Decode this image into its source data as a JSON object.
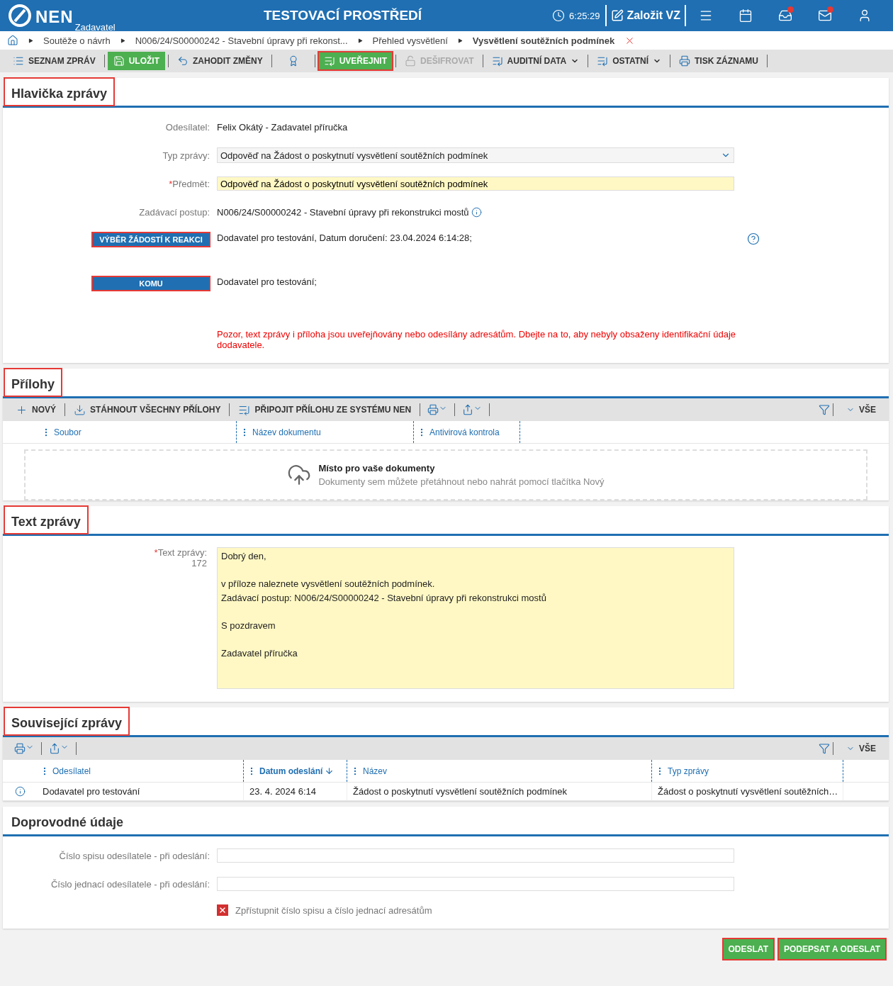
{
  "header": {
    "logo": "NEN",
    "role": "Zadavatel",
    "environment": "TESTOVACÍ PROSTŘEDÍ",
    "time": "6:25:29",
    "create_button": "Založit VZ",
    "icons": [
      {
        "kind": "menu",
        "badge": false
      },
      {
        "kind": "calendar",
        "badge": false
      },
      {
        "kind": "inbox",
        "badge": true
      },
      {
        "kind": "mail",
        "badge": true
      },
      {
        "kind": "user",
        "badge": false
      }
    ]
  },
  "breadcrumbs": [
    {
      "label": "Soutěže o návrh",
      "current": false
    },
    {
      "label": "N006/24/S00000242 - Stavební úpravy při rekonst...",
      "current": false
    },
    {
      "label": "Přehled vysvětlení",
      "current": false
    },
    {
      "label": "Vysvětlení soutěžních podmínek",
      "current": true
    }
  ],
  "toolbar": [
    {
      "label": "SEZNAM ZPRÁV",
      "kind": "plain",
      "highlighted": false,
      "dropdown": false
    },
    {
      "label": "ULOŽIT",
      "kind": "green",
      "highlighted": false,
      "dropdown": false
    },
    {
      "label": "ZAHODIT ZMĚNY",
      "kind": "plain",
      "highlighted": false,
      "dropdown": false
    },
    {
      "kind": "icon",
      "highlighted": false,
      "dropdown": false
    },
    {
      "label": "UVEŘEJNIT",
      "kind": "green",
      "highlighted": true,
      "dropdown": false
    },
    {
      "label": "DEŠIFROVAT",
      "kind": "disabled",
      "highlighted": false,
      "dropdown": false
    },
    {
      "label": "AUDITNÍ DATA",
      "kind": "plain",
      "highlighted": false,
      "dropdown": true
    },
    {
      "label": "OSTATNÍ",
      "kind": "plain",
      "highlighted": false,
      "dropdown": true
    },
    {
      "label": "TISK ZÁZNAMU",
      "kind": "plain",
      "highlighted": false,
      "dropdown": false
    }
  ],
  "message_header": {
    "title": "Hlavička zprávy",
    "highlighted": true,
    "fields": [
      {
        "kind": "static",
        "label": "Odesílatel:",
        "value": "Felix Okátý - Zadavatel příručka"
      },
      {
        "kind": "select",
        "label": "Typ zprávy:",
        "value": "Odpověď na Žádost o poskytnutí vysvětlení soutěžních podmínek"
      },
      {
        "kind": "input",
        "required_mark": "*",
        "label": "Předmět:",
        "value": "Odpověď na Žádost o poskytnutí vysvětlení soutěžních podmínek"
      },
      {
        "kind": "info",
        "label": "Zadávací postup:",
        "value": "N006/24/S00000242 - Stavební úpravy při rekonstrukci mostů"
      },
      {
        "kind": "action",
        "button": "VÝBĚR ŽÁDOSTÍ K REAKCI",
        "highlighted": true,
        "help": true,
        "value": "Dodavatel pro testování, Datum doručení: 23.04.2024 6:14:28;"
      },
      {
        "kind": "action",
        "button": "KOMU",
        "highlighted": true,
        "help": false,
        "value": "Dodavatel pro testování;"
      }
    ],
    "warning": "Pozor, text zprávy i příloha jsou uveřejňovány nebo odesílány adresátům. Dbejte na to, aby nebyly obsaženy identifikační údaje dodavatele."
  },
  "attachments": {
    "title": "Přílohy",
    "highlighted": true,
    "actions": [
      "NOVÝ",
      "STÁHNOUT VŠECHNY PŘÍLOHY",
      "PŘIPOJIT PŘÍLOHU ZE SYSTÉMU NEN"
    ],
    "filter": "VŠE",
    "columns": [
      "Soubor",
      "Název dokumentu",
      "Antivirová kontrola"
    ],
    "dropzone": {
      "title": "Místo pro vaše dokumenty",
      "hint": "Dokumenty sem můžete přetáhnout nebo nahrát pomocí tlačítka Nový"
    }
  },
  "message_text": {
    "title": "Text zprávy",
    "highlighted": true,
    "required_mark": "*",
    "label": "Text zprávy:",
    "count": "172",
    "value": "Dobrý den,\n\nv příloze naleznete vysvětlení soutěžních podmínek.\nZadávací postup: N006/24/S00000242 - Stavební úpravy při rekonstrukci mostů\n\nS pozdravem\n\nZadavatel příručka"
  },
  "related": {
    "title": "Související zprávy",
    "highlighted": true,
    "filter": "VŠE",
    "columns": [
      {
        "label": "Odesílatel",
        "sorted": false
      },
      {
        "label": "Datum odeslání",
        "sorted": true
      },
      {
        "label": "Název",
        "sorted": false
      },
      {
        "label": "Typ zprávy",
        "sorted": false
      }
    ],
    "rows": [
      {
        "cells": [
          "Dodavatel pro testování",
          "23. 4. 2024 6:14",
          "Žádost o poskytnutí vysvětlení soutěžních podmínek",
          "Žádost o poskytnutí vysvětlení soutěžních…"
        ]
      }
    ]
  },
  "details": {
    "title": "Doprovodné údaje",
    "highlighted": false,
    "fields": [
      {
        "label": "Číslo spisu odesílatele - při odeslání:"
      },
      {
        "label": "Číslo jednací odesílatele - při odeslání:"
      }
    ],
    "checkbox": {
      "label": "Zpřístupnit číslo spisu a číslo jednací adresátům",
      "checked": false
    }
  },
  "footer_buttons": [
    {
      "label": "ODESLAT",
      "highlighted": true
    },
    {
      "label": "PODEPSAT A ODESLAT",
      "highlighted": true
    }
  ]
}
